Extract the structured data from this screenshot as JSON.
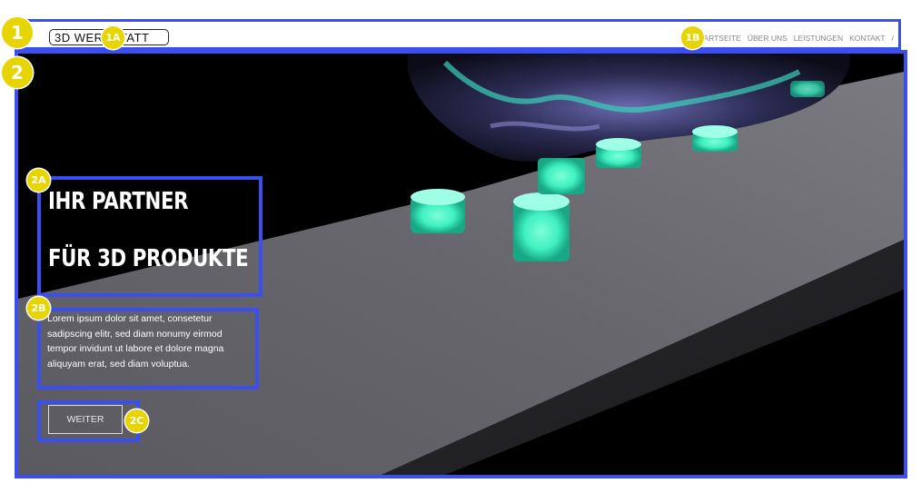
{
  "header": {
    "logo_text": "3D WERKSTATT",
    "nav": [
      "STARTSEITE",
      "ÜBER UNS",
      "LEISTUNGEN",
      "KONTAKT",
      "/"
    ]
  },
  "hero": {
    "heading_line1": "IHR PARTNER",
    "heading_line2": "FÜR 3D PRODUKTE",
    "body": "Lorem ipsum dolor sit amet, consetetur sadipscing elitr, sed diam nonumy eirmod tempor invidunt ut labore et dolore magna aliquyam erat, sed diam voluptua.",
    "button_label": "WEITER"
  },
  "annotations": {
    "m1": "1",
    "m1a": "1A",
    "m1b": "1B",
    "m2": "2",
    "m2a": "2A",
    "m2b": "2B",
    "m2c": "2C"
  },
  "colors": {
    "annotation_border": "#3b4ef0",
    "marker": "#e8d400",
    "glow": "#3ff0c0"
  }
}
